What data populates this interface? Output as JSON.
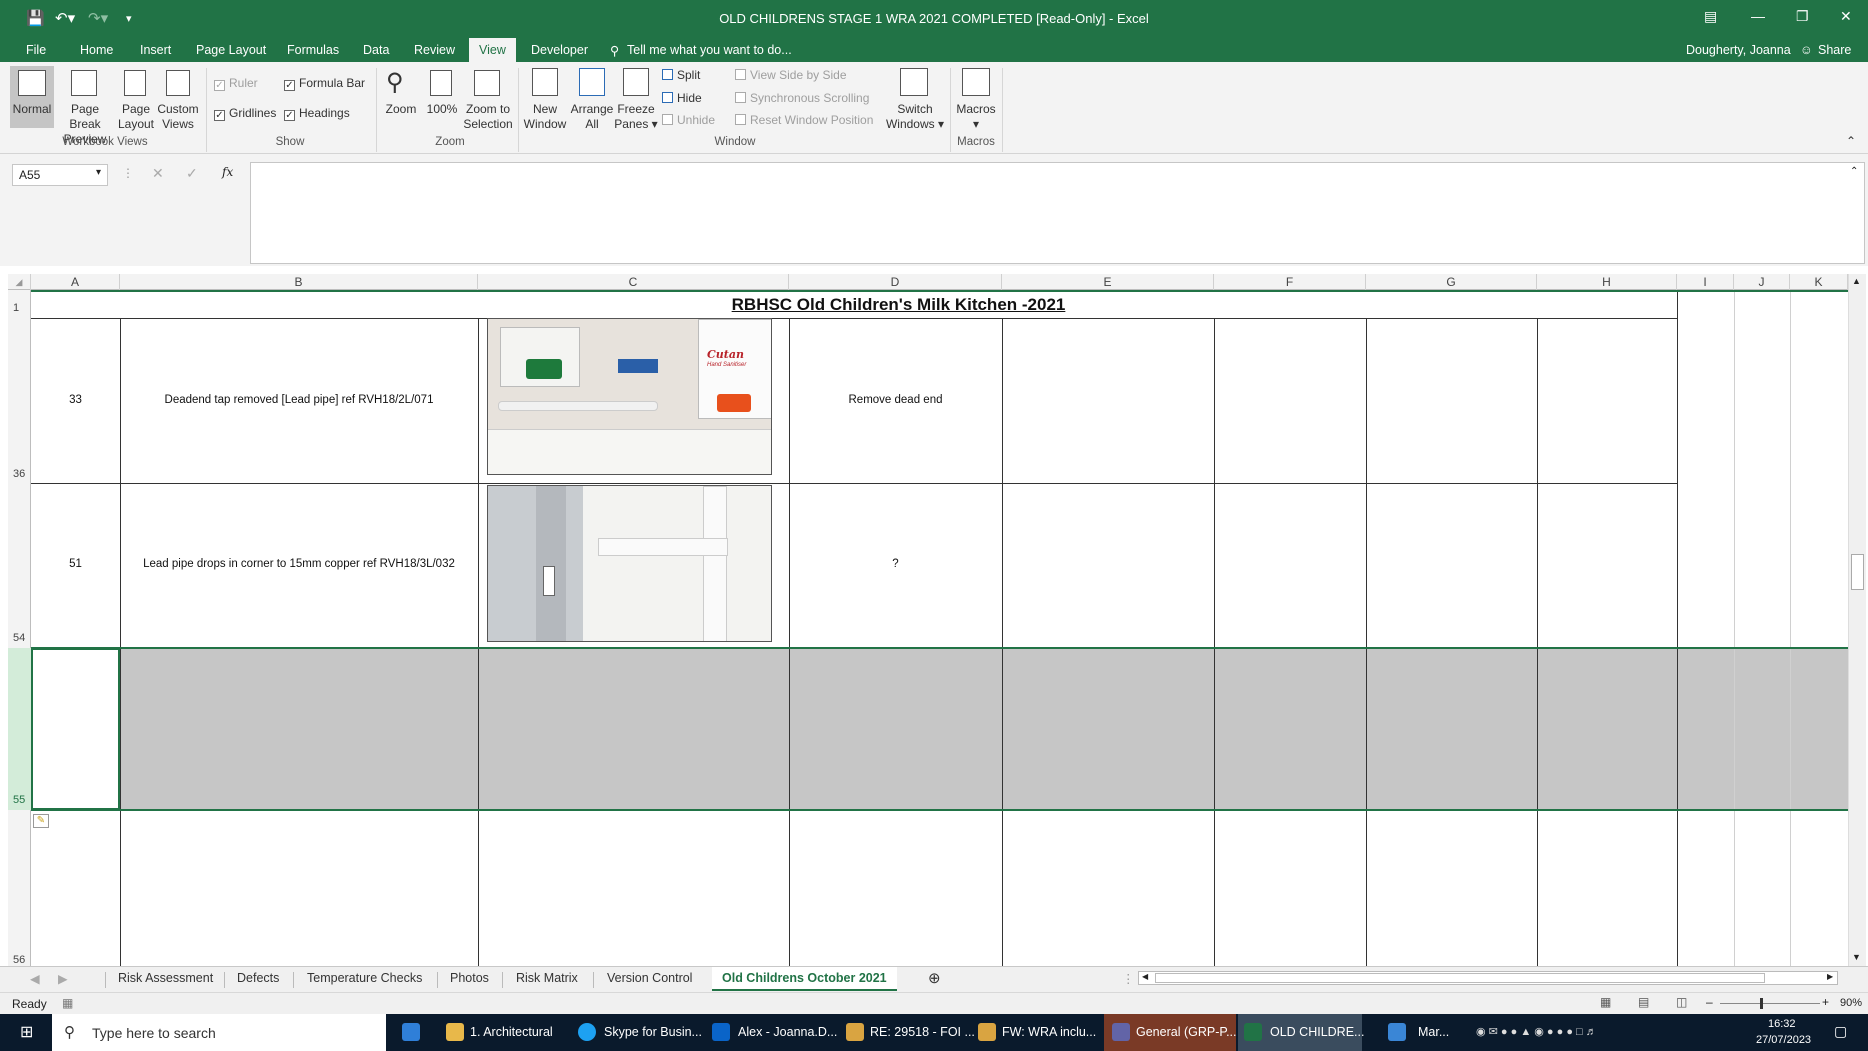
{
  "window": {
    "title": "OLD CHILDRENS STAGE 1 WRA 2021 COMPLETED  [Read-Only] - Excel",
    "user": "Dougherty, Joanna",
    "share": "Share"
  },
  "menu": {
    "tabs": [
      "File",
      "Home",
      "Insert",
      "Page Layout",
      "Formulas",
      "Data",
      "Review",
      "View",
      "Developer"
    ],
    "active": "View",
    "tell_me": "Tell me what you want to do..."
  },
  "ribbon": {
    "workbook_views": {
      "normal": "Normal",
      "page_break_1": "Page Break",
      "page_break_2": "Preview",
      "page_layout_1": "Page",
      "page_layout_2": "Layout",
      "custom_1": "Custom",
      "custom_2": "Views",
      "group": "Workbook Views"
    },
    "show": {
      "ruler": "Ruler",
      "formula_bar": "Formula Bar",
      "gridlines": "Gridlines",
      "headings": "Headings",
      "group": "Show"
    },
    "zoom": {
      "zoom": "Zoom",
      "pct": "100%",
      "zts_1": "Zoom to",
      "zts_2": "Selection",
      "group": "Zoom"
    },
    "window": {
      "new_1": "New",
      "new_2": "Window",
      "arrange_1": "Arrange",
      "arrange_2": "All",
      "freeze_1": "Freeze",
      "freeze_2": "Panes",
      "split": "Split",
      "hide": "Hide",
      "unhide": "Unhide",
      "side_by_side": "View Side by Side",
      "sync_scroll": "Synchronous Scrolling",
      "reset_pos": "Reset Window Position",
      "switch_1": "Switch",
      "switch_2": "Windows",
      "group": "Window"
    },
    "macros": {
      "label": "Macros",
      "group": "Macros"
    }
  },
  "formula_bar": {
    "name_box": "A55",
    "formula": "",
    "fx": "fx"
  },
  "columns": [
    "A",
    "B",
    "C",
    "D",
    "E",
    "F",
    "G",
    "H",
    "I",
    "J",
    "K"
  ],
  "rows": [
    "1",
    "36",
    "54",
    "55",
    "56"
  ],
  "sheet_title": "RBHSC Old Children's Milk Kitchen -2021",
  "entries": [
    {
      "num": "33",
      "description": "Deadend tap removed [Lead pipe] ref  RVH18/2L/071",
      "action": "Remove dead end"
    },
    {
      "num": "51",
      "description": "Lead pipe drops in corner to 15mm copper  ref  RVH18/3L/032",
      "action": "?"
    }
  ],
  "photo_labels": {
    "cutan_1": "Cutan",
    "cutan_2": "Hand Sanitiser"
  },
  "sheet_tabs": [
    "Risk Assessment",
    "Defects",
    "Temperature Checks",
    "Photos",
    "Risk Matrix",
    "Version Control",
    "Old Childrens October 2021"
  ],
  "active_sheet": "Old Childrens October 2021",
  "status": {
    "ready": "Ready",
    "zoom": "90%"
  },
  "taskbar": {
    "search_placeholder": "Type here to search",
    "items": [
      "1. Architectural",
      "Skype for Busin...",
      "Alex - Joanna.D...",
      "RE: 29518 - FOI ...",
      "FW: WRA inclu...",
      "General (GRP-P...",
      "OLD CHILDRE...",
      "Mar..."
    ],
    "time": "16:32",
    "date": "27/07/2023"
  },
  "colors": {
    "excel_green": "#217346",
    "selection_gray": "#c6c6c6",
    "taskbar": "#0a1a2c"
  }
}
